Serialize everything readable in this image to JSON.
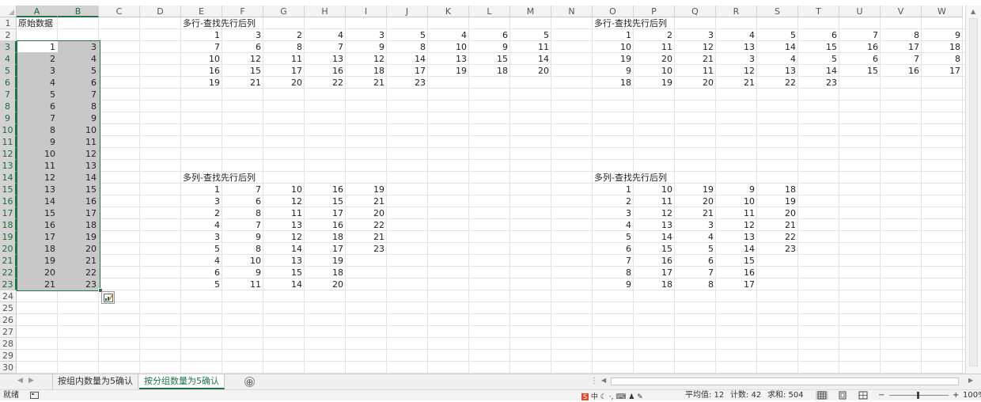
{
  "column_letters": [
    "A",
    "B",
    "C",
    "D",
    "E",
    "F",
    "G",
    "H",
    "I",
    "J",
    "K",
    "L",
    "M",
    "N",
    "O",
    "P",
    "Q",
    "R",
    "S",
    "T",
    "U",
    "V",
    "W"
  ],
  "row_numbers": [
    "1",
    "2",
    "3",
    "4",
    "5",
    "6",
    "7",
    "8",
    "9",
    "10",
    "11",
    "12",
    "13",
    "14",
    "15",
    "16",
    "17",
    "18",
    "19",
    "20",
    "21",
    "22",
    "23",
    "24",
    "25",
    "26",
    "27",
    "28",
    "29",
    "30"
  ],
  "cells": [
    {
      "ref": "A1",
      "value": "原始数据",
      "type": "text"
    },
    {
      "ref": "A3",
      "value": "1"
    },
    {
      "ref": "B3",
      "value": "3"
    },
    {
      "ref": "A4",
      "value": "2"
    },
    {
      "ref": "B4",
      "value": "4"
    },
    {
      "ref": "A5",
      "value": "3"
    },
    {
      "ref": "B5",
      "value": "5"
    },
    {
      "ref": "A6",
      "value": "4"
    },
    {
      "ref": "B6",
      "value": "6"
    },
    {
      "ref": "A7",
      "value": "5"
    },
    {
      "ref": "B7",
      "value": "7"
    },
    {
      "ref": "A8",
      "value": "6"
    },
    {
      "ref": "B8",
      "value": "8"
    },
    {
      "ref": "A9",
      "value": "7"
    },
    {
      "ref": "B9",
      "value": "9"
    },
    {
      "ref": "A10",
      "value": "8"
    },
    {
      "ref": "B10",
      "value": "10"
    },
    {
      "ref": "A11",
      "value": "9"
    },
    {
      "ref": "B11",
      "value": "11"
    },
    {
      "ref": "A12",
      "value": "10"
    },
    {
      "ref": "B12",
      "value": "12"
    },
    {
      "ref": "A13",
      "value": "11"
    },
    {
      "ref": "B13",
      "value": "13"
    },
    {
      "ref": "A14",
      "value": "12"
    },
    {
      "ref": "B14",
      "value": "14"
    },
    {
      "ref": "A15",
      "value": "13"
    },
    {
      "ref": "B15",
      "value": "15"
    },
    {
      "ref": "A16",
      "value": "14"
    },
    {
      "ref": "B16",
      "value": "16"
    },
    {
      "ref": "A17",
      "value": "15"
    },
    {
      "ref": "B17",
      "value": "17"
    },
    {
      "ref": "A18",
      "value": "16"
    },
    {
      "ref": "B18",
      "value": "18"
    },
    {
      "ref": "A19",
      "value": "17"
    },
    {
      "ref": "B19",
      "value": "19"
    },
    {
      "ref": "A20",
      "value": "18"
    },
    {
      "ref": "B20",
      "value": "20"
    },
    {
      "ref": "A21",
      "value": "19"
    },
    {
      "ref": "B21",
      "value": "21"
    },
    {
      "ref": "A22",
      "value": "20"
    },
    {
      "ref": "B22",
      "value": "22"
    },
    {
      "ref": "A23",
      "value": "21"
    },
    {
      "ref": "B23",
      "value": "23"
    },
    {
      "ref": "E1",
      "value": "多行-查找先行后列",
      "type": "text"
    },
    {
      "ref": "E2",
      "value": "1"
    },
    {
      "ref": "F2",
      "value": "3"
    },
    {
      "ref": "G2",
      "value": "2"
    },
    {
      "ref": "H2",
      "value": "4"
    },
    {
      "ref": "I2",
      "value": "3"
    },
    {
      "ref": "J2",
      "value": "5"
    },
    {
      "ref": "K2",
      "value": "4"
    },
    {
      "ref": "L2",
      "value": "6"
    },
    {
      "ref": "M2",
      "value": "5"
    },
    {
      "ref": "E3",
      "value": "7"
    },
    {
      "ref": "F3",
      "value": "6"
    },
    {
      "ref": "G3",
      "value": "8"
    },
    {
      "ref": "H3",
      "value": "7"
    },
    {
      "ref": "I3",
      "value": "9"
    },
    {
      "ref": "J3",
      "value": "8"
    },
    {
      "ref": "K3",
      "value": "10"
    },
    {
      "ref": "L3",
      "value": "9"
    },
    {
      "ref": "M3",
      "value": "11"
    },
    {
      "ref": "E4",
      "value": "10"
    },
    {
      "ref": "F4",
      "value": "12"
    },
    {
      "ref": "G4",
      "value": "11"
    },
    {
      "ref": "H4",
      "value": "13"
    },
    {
      "ref": "I4",
      "value": "12"
    },
    {
      "ref": "J4",
      "value": "14"
    },
    {
      "ref": "K4",
      "value": "13"
    },
    {
      "ref": "L4",
      "value": "15"
    },
    {
      "ref": "M4",
      "value": "14"
    },
    {
      "ref": "E5",
      "value": "16"
    },
    {
      "ref": "F5",
      "value": "15"
    },
    {
      "ref": "G5",
      "value": "17"
    },
    {
      "ref": "H5",
      "value": "16"
    },
    {
      "ref": "I5",
      "value": "18"
    },
    {
      "ref": "J5",
      "value": "17"
    },
    {
      "ref": "K5",
      "value": "19"
    },
    {
      "ref": "L5",
      "value": "18"
    },
    {
      "ref": "M5",
      "value": "20"
    },
    {
      "ref": "E6",
      "value": "19"
    },
    {
      "ref": "F6",
      "value": "21"
    },
    {
      "ref": "G6",
      "value": "20"
    },
    {
      "ref": "H6",
      "value": "22"
    },
    {
      "ref": "I6",
      "value": "21"
    },
    {
      "ref": "J6",
      "value": "23"
    },
    {
      "ref": "O1",
      "value": "多行-查找先行后列",
      "type": "text"
    },
    {
      "ref": "O2",
      "value": "1"
    },
    {
      "ref": "P2",
      "value": "2"
    },
    {
      "ref": "Q2",
      "value": "3"
    },
    {
      "ref": "R2",
      "value": "4"
    },
    {
      "ref": "S2",
      "value": "5"
    },
    {
      "ref": "T2",
      "value": "6"
    },
    {
      "ref": "U2",
      "value": "7"
    },
    {
      "ref": "V2",
      "value": "8"
    },
    {
      "ref": "W2",
      "value": "9"
    },
    {
      "ref": "O3",
      "value": "10"
    },
    {
      "ref": "P3",
      "value": "11"
    },
    {
      "ref": "Q3",
      "value": "12"
    },
    {
      "ref": "R3",
      "value": "13"
    },
    {
      "ref": "S3",
      "value": "14"
    },
    {
      "ref": "T3",
      "value": "15"
    },
    {
      "ref": "U3",
      "value": "16"
    },
    {
      "ref": "V3",
      "value": "17"
    },
    {
      "ref": "W3",
      "value": "18"
    },
    {
      "ref": "O4",
      "value": "19"
    },
    {
      "ref": "P4",
      "value": "20"
    },
    {
      "ref": "Q4",
      "value": "21"
    },
    {
      "ref": "R4",
      "value": "3"
    },
    {
      "ref": "S4",
      "value": "4"
    },
    {
      "ref": "T4",
      "value": "5"
    },
    {
      "ref": "U4",
      "value": "6"
    },
    {
      "ref": "V4",
      "value": "7"
    },
    {
      "ref": "W4",
      "value": "8"
    },
    {
      "ref": "O5",
      "value": "9"
    },
    {
      "ref": "P5",
      "value": "10"
    },
    {
      "ref": "Q5",
      "value": "11"
    },
    {
      "ref": "R5",
      "value": "12"
    },
    {
      "ref": "S5",
      "value": "13"
    },
    {
      "ref": "T5",
      "value": "14"
    },
    {
      "ref": "U5",
      "value": "15"
    },
    {
      "ref": "V5",
      "value": "16"
    },
    {
      "ref": "W5",
      "value": "17"
    },
    {
      "ref": "O6",
      "value": "18"
    },
    {
      "ref": "P6",
      "value": "19"
    },
    {
      "ref": "Q6",
      "value": "20"
    },
    {
      "ref": "R6",
      "value": "21"
    },
    {
      "ref": "S6",
      "value": "22"
    },
    {
      "ref": "T6",
      "value": "23"
    },
    {
      "ref": "E14",
      "value": "多列-查找先行后列",
      "type": "text"
    },
    {
      "ref": "E15",
      "value": "1"
    },
    {
      "ref": "F15",
      "value": "7"
    },
    {
      "ref": "G15",
      "value": "10"
    },
    {
      "ref": "H15",
      "value": "16"
    },
    {
      "ref": "I15",
      "value": "19"
    },
    {
      "ref": "E16",
      "value": "3"
    },
    {
      "ref": "F16",
      "value": "6"
    },
    {
      "ref": "G16",
      "value": "12"
    },
    {
      "ref": "H16",
      "value": "15"
    },
    {
      "ref": "I16",
      "value": "21"
    },
    {
      "ref": "E17",
      "value": "2"
    },
    {
      "ref": "F17",
      "value": "8"
    },
    {
      "ref": "G17",
      "value": "11"
    },
    {
      "ref": "H17",
      "value": "17"
    },
    {
      "ref": "I17",
      "value": "20"
    },
    {
      "ref": "E18",
      "value": "4"
    },
    {
      "ref": "F18",
      "value": "7"
    },
    {
      "ref": "G18",
      "value": "13"
    },
    {
      "ref": "H18",
      "value": "16"
    },
    {
      "ref": "I18",
      "value": "22"
    },
    {
      "ref": "E19",
      "value": "3"
    },
    {
      "ref": "F19",
      "value": "9"
    },
    {
      "ref": "G19",
      "value": "12"
    },
    {
      "ref": "H19",
      "value": "18"
    },
    {
      "ref": "I19",
      "value": "21"
    },
    {
      "ref": "E20",
      "value": "5"
    },
    {
      "ref": "F20",
      "value": "8"
    },
    {
      "ref": "G20",
      "value": "14"
    },
    {
      "ref": "H20",
      "value": "17"
    },
    {
      "ref": "I20",
      "value": "23"
    },
    {
      "ref": "E21",
      "value": "4"
    },
    {
      "ref": "F21",
      "value": "10"
    },
    {
      "ref": "G21",
      "value": "13"
    },
    {
      "ref": "H21",
      "value": "19"
    },
    {
      "ref": "E22",
      "value": "6"
    },
    {
      "ref": "F22",
      "value": "9"
    },
    {
      "ref": "G22",
      "value": "15"
    },
    {
      "ref": "H22",
      "value": "18"
    },
    {
      "ref": "E23",
      "value": "5"
    },
    {
      "ref": "F23",
      "value": "11"
    },
    {
      "ref": "G23",
      "value": "14"
    },
    {
      "ref": "H23",
      "value": "20"
    },
    {
      "ref": "O14",
      "value": "多列-查找先行后列",
      "type": "text"
    },
    {
      "ref": "O15",
      "value": "1"
    },
    {
      "ref": "P15",
      "value": "10"
    },
    {
      "ref": "Q15",
      "value": "19"
    },
    {
      "ref": "R15",
      "value": "9"
    },
    {
      "ref": "S15",
      "value": "18"
    },
    {
      "ref": "O16",
      "value": "2"
    },
    {
      "ref": "P16",
      "value": "11"
    },
    {
      "ref": "Q16",
      "value": "20"
    },
    {
      "ref": "R16",
      "value": "10"
    },
    {
      "ref": "S16",
      "value": "19"
    },
    {
      "ref": "O17",
      "value": "3"
    },
    {
      "ref": "P17",
      "value": "12"
    },
    {
      "ref": "Q17",
      "value": "21"
    },
    {
      "ref": "R17",
      "value": "11"
    },
    {
      "ref": "S17",
      "value": "20"
    },
    {
      "ref": "O18",
      "value": "4"
    },
    {
      "ref": "P18",
      "value": "13"
    },
    {
      "ref": "Q18",
      "value": "3"
    },
    {
      "ref": "R18",
      "value": "12"
    },
    {
      "ref": "S18",
      "value": "21"
    },
    {
      "ref": "O19",
      "value": "5"
    },
    {
      "ref": "P19",
      "value": "14"
    },
    {
      "ref": "Q19",
      "value": "4"
    },
    {
      "ref": "R19",
      "value": "13"
    },
    {
      "ref": "S19",
      "value": "22"
    },
    {
      "ref": "O20",
      "value": "6"
    },
    {
      "ref": "P20",
      "value": "15"
    },
    {
      "ref": "Q20",
      "value": "5"
    },
    {
      "ref": "R20",
      "value": "14"
    },
    {
      "ref": "S20",
      "value": "23"
    },
    {
      "ref": "O21",
      "value": "7"
    },
    {
      "ref": "P21",
      "value": "16"
    },
    {
      "ref": "Q21",
      "value": "6"
    },
    {
      "ref": "R21",
      "value": "15"
    },
    {
      "ref": "O22",
      "value": "8"
    },
    {
      "ref": "P22",
      "value": "17"
    },
    {
      "ref": "Q22",
      "value": "7"
    },
    {
      "ref": "R22",
      "value": "16"
    },
    {
      "ref": "O23",
      "value": "9"
    },
    {
      "ref": "P23",
      "value": "18"
    },
    {
      "ref": "Q23",
      "value": "8"
    },
    {
      "ref": "R23",
      "value": "17"
    }
  ],
  "selection": {
    "range": "A3:B23",
    "active_cell": "A3",
    "selected_columns": [
      "A",
      "B"
    ],
    "selected_rows_from": 3,
    "selected_rows_to": 23
  },
  "quick_analysis_icon": "quick-analysis-icon",
  "sheet_tabs": [
    {
      "label": "按组内数量为5确认",
      "active": false
    },
    {
      "label": "按分组数量为5确认",
      "active": true
    }
  ],
  "add_sheet_label": "⊕",
  "status": {
    "ready": "就绪",
    "ime_label": "中",
    "average": "平均值: 12",
    "count": "计数: 42",
    "sum": "求和: 504",
    "zoom": "100%"
  },
  "colors": {
    "accent": "#217346",
    "selection_fill": "#c8c8c8",
    "header_bg": "#f3f3f3"
  }
}
